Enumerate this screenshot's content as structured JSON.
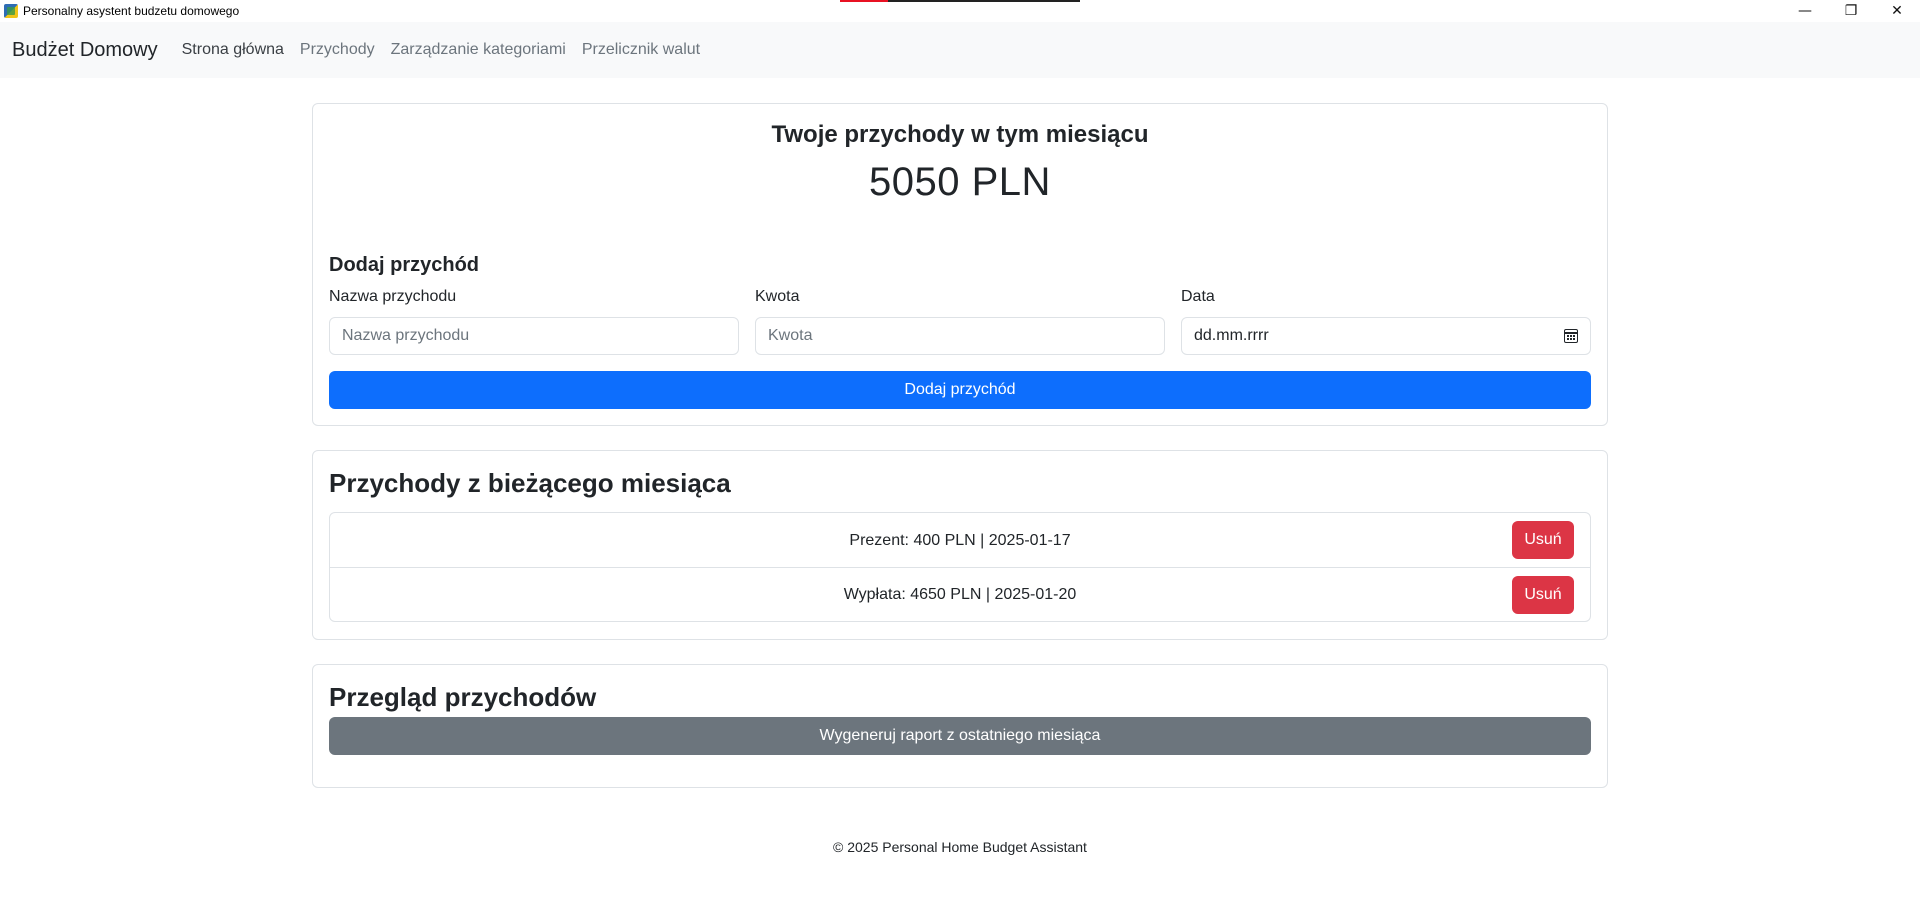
{
  "window": {
    "title": "Personalny asystent budzetu domowego",
    "controls": {
      "minimize": "—",
      "restore": "❐",
      "close": "✕"
    }
  },
  "navbar": {
    "brand": "Budżet Domowy",
    "links": [
      "Strona główna",
      "Przychody",
      "Zarządzanie kategoriami",
      "Przelicznik walut"
    ]
  },
  "summary": {
    "title": "Twoje przychody w tym miesiącu",
    "amount": "5050 PLN"
  },
  "form": {
    "title": "Dodaj przychód",
    "name_label": "Nazwa przychodu",
    "name_placeholder": "Nazwa przychodu",
    "amount_label": "Kwota",
    "amount_placeholder": "Kwota",
    "date_label": "Data",
    "date_placeholder": "dd.mm.rrrr",
    "submit_label": "Dodaj przychód"
  },
  "income_list": {
    "title": "Przychody z bieżącego miesiąca",
    "items": [
      {
        "text": "Prezent: 400 PLN | 2025-01-17",
        "delete_label": "Usuń"
      },
      {
        "text": "Wypłata: 4650 PLN | 2025-01-20",
        "delete_label": "Usuń"
      }
    ]
  },
  "review": {
    "title": "Przegląd przychodów",
    "report_button": "Wygeneruj raport z ostatniego miesiąca"
  },
  "footer": {
    "text": "© 2025 Personal Home Budget Assistant"
  },
  "colors": {
    "primary": "#0d6efd",
    "secondary": "#6c757d",
    "danger": "#dc3545",
    "navbar_bg": "#f8f9fa"
  }
}
